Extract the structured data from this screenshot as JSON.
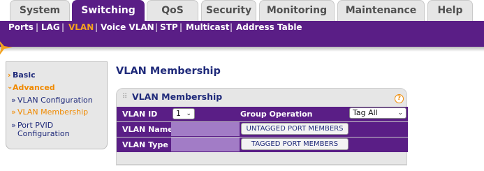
{
  "tabs": [
    {
      "label": "System"
    },
    {
      "label": "Switching"
    },
    {
      "label": "QoS"
    },
    {
      "label": "Security"
    },
    {
      "label": "Monitoring"
    },
    {
      "label": "Maintenance"
    },
    {
      "label": "Help"
    }
  ],
  "subnav": [
    {
      "label": "Ports"
    },
    {
      "label": "LAG"
    },
    {
      "label": "VLAN"
    },
    {
      "label": "Voice VLAN"
    },
    {
      "label": "STP"
    },
    {
      "label": "Multicast"
    },
    {
      "label": "Address Table"
    }
  ],
  "leftmenu": {
    "basic": "Basic",
    "advanced": "Advanced",
    "items": [
      {
        "label": "VLAN Configuration"
      },
      {
        "label": "VLAN Membership"
      },
      {
        "label": "Port PVID"
      },
      {
        "label": "Configuration"
      }
    ]
  },
  "page": {
    "title": "VLAN Membership"
  },
  "panel": {
    "title": "VLAN Membership",
    "help": "?",
    "vlan_id_label": "VLAN ID",
    "vlan_id_value": "1",
    "group_operation_label": "Group Operation",
    "group_operation_value": "Tag All",
    "vlan_name_label": "VLAN Name",
    "vlan_type_label": "VLAN Type",
    "untagged_button": "UNTAGGED PORT MEMBERS",
    "tagged_button": "TAGGED PORT MEMBERS"
  },
  "colors": {
    "brand_purple": "#5a1e86",
    "accent_orange": "#f08a00",
    "field_purple": "#a27cc6"
  }
}
